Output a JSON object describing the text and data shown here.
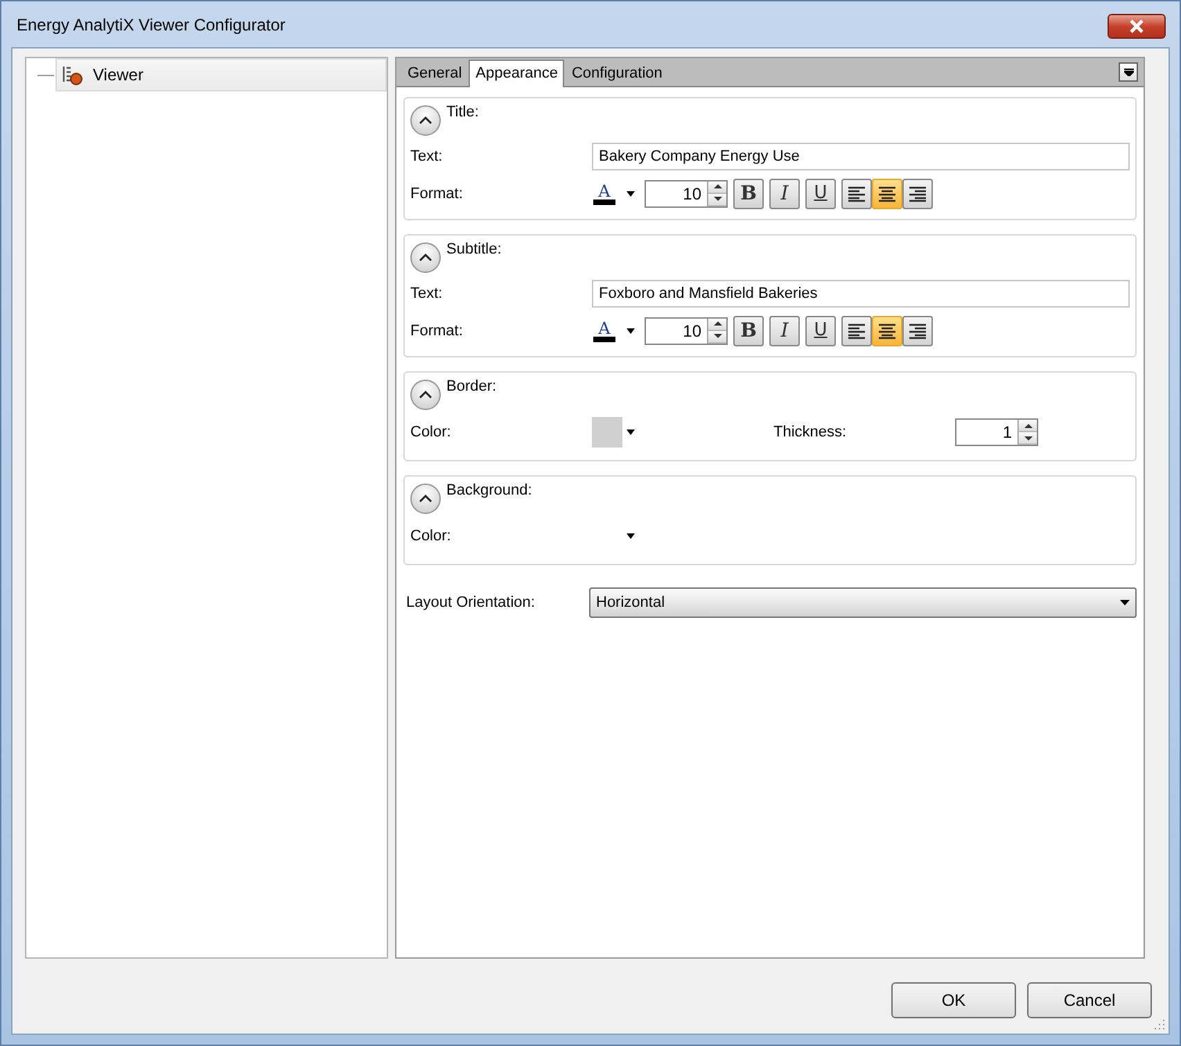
{
  "window": {
    "title": "Energy AnalytiX Viewer Configurator"
  },
  "tree": {
    "items": [
      {
        "label": "Viewer",
        "selected": true
      }
    ]
  },
  "tabs": [
    {
      "label": "General",
      "selected": false
    },
    {
      "label": "Appearance",
      "selected": true
    },
    {
      "label": "Configuration",
      "selected": false
    }
  ],
  "sections": [
    {
      "title": "Title:",
      "expanded": true,
      "rows": [
        {
          "kind": "text",
          "label": "Text:",
          "value": "Bakery Company Energy Use"
        },
        {
          "kind": "format",
          "label": "Format:",
          "font_glyph": "A",
          "size": "10",
          "styles": [
            {
              "glyph": "B",
              "pressed": false
            },
            {
              "glyph": "I",
              "pressed": false
            },
            {
              "glyph": "U",
              "pressed": false
            }
          ],
          "alignments": [
            {
              "selected": false
            },
            {
              "selected": true
            },
            {
              "selected": false
            }
          ]
        }
      ]
    },
    {
      "title": "Subtitle:",
      "expanded": true,
      "rows": [
        {
          "kind": "text",
          "label": "Text:",
          "value": "Foxboro and Mansfield Bakeries"
        },
        {
          "kind": "format",
          "label": "Format:",
          "font_glyph": "A",
          "size": "10",
          "styles": [
            {
              "glyph": "B",
              "pressed": false
            },
            {
              "glyph": "I",
              "pressed": false
            },
            {
              "glyph": "U",
              "pressed": false
            }
          ],
          "alignments": [
            {
              "selected": false
            },
            {
              "selected": true
            },
            {
              "selected": false
            }
          ]
        }
      ]
    },
    {
      "title": "Border:",
      "expanded": true,
      "rows": [
        {
          "kind": "color",
          "label": "Color:",
          "color": "#d0d0d0",
          "thickness_label": "Thickness:",
          "thickness": "1"
        }
      ]
    },
    {
      "title": "Background:",
      "expanded": true,
      "rows": [
        {
          "kind": "color",
          "label": "Color:"
        }
      ]
    }
  ],
  "layout_orientation": {
    "label": "Layout Orientation:",
    "value": "Horizontal"
  },
  "buttons": [
    "OK",
    "Cancel"
  ]
}
